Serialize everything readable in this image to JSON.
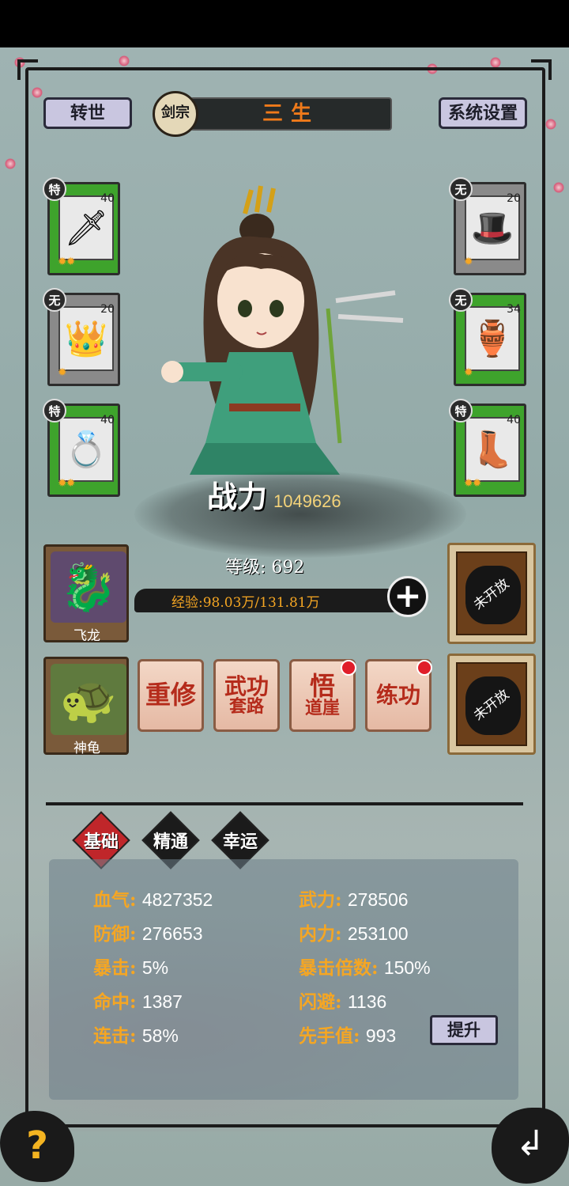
{
  "header": {
    "rebirth_label": "转世",
    "sect_label": "剑宗",
    "player_name": "三生",
    "settings_label": "系统设置"
  },
  "equipment_left": [
    {
      "grade": "特",
      "level": "40",
      "icon": "sword-icon",
      "glyph": "🗡",
      "stars": "✹✹",
      "rarity": "green"
    },
    {
      "grade": "无",
      "level": "20",
      "icon": "helmet-icon",
      "glyph": "👑",
      "stars": "✹",
      "rarity": "gray"
    },
    {
      "grade": "特",
      "level": "40",
      "icon": "ring-icon",
      "glyph": "💍",
      "stars": "✹✹",
      "rarity": "green"
    }
  ],
  "equipment_right": [
    {
      "grade": "无",
      "level": "20",
      "icon": "hat-icon",
      "glyph": "🎩",
      "stars": "✹",
      "rarity": "gray"
    },
    {
      "grade": "无",
      "level": "34",
      "icon": "gourd-icon",
      "glyph": "🏺",
      "stars": "✹",
      "rarity": "green"
    },
    {
      "grade": "特",
      "level": "40",
      "icon": "boots-icon",
      "glyph": "👢",
      "stars": "✹✹",
      "rarity": "green"
    }
  ],
  "power": {
    "label": "战力",
    "value": "1049626"
  },
  "level": {
    "text": "等级: 692"
  },
  "exp": {
    "text": "经验:98.03万/131.81万"
  },
  "pets": [
    {
      "name": "飞龙",
      "glyph": "🐉",
      "icon": "dragon-icon"
    },
    {
      "name": "神龟",
      "glyph": "🐢",
      "icon": "turtle-icon"
    }
  ],
  "locked_slot_label": "未开放",
  "actions": [
    {
      "line1": "重修",
      "line2": "",
      "has_dot": false
    },
    {
      "line1": "武功",
      "line2": "套路",
      "has_dot": false
    },
    {
      "line1": "悟",
      "line2": "道崖",
      "has_dot": true
    },
    {
      "line1": "练功",
      "line2": "",
      "has_dot": true
    }
  ],
  "tabs": [
    {
      "label": "基础",
      "active": true
    },
    {
      "label": "精通",
      "active": false
    },
    {
      "label": "幸运",
      "active": false
    }
  ],
  "stats": {
    "hp": {
      "k": "血气:",
      "v": "4827352"
    },
    "atk": {
      "k": "武力:",
      "v": "278506"
    },
    "def": {
      "k": "防御:",
      "v": "276653"
    },
    "inner": {
      "k": "内力:",
      "v": "253100"
    },
    "crit": {
      "k": "暴击:",
      "v": "5%"
    },
    "crit_mult": {
      "k": "暴击倍数:",
      "v": "150%"
    },
    "hit": {
      "k": "命中:",
      "v": "1387"
    },
    "dodge": {
      "k": "闪避:",
      "v": "1136"
    },
    "combo": {
      "k": "连击:",
      "v": "58%"
    },
    "initiative": {
      "k": "先手值:",
      "v": "993"
    }
  },
  "upgrade_label": "提升",
  "help_label": "?",
  "back_label": "↲",
  "colors": {
    "accent": "#f5a623",
    "name": "#f07a1a",
    "equip_green": "#3ea32c",
    "tab_active": "#c0262a"
  }
}
